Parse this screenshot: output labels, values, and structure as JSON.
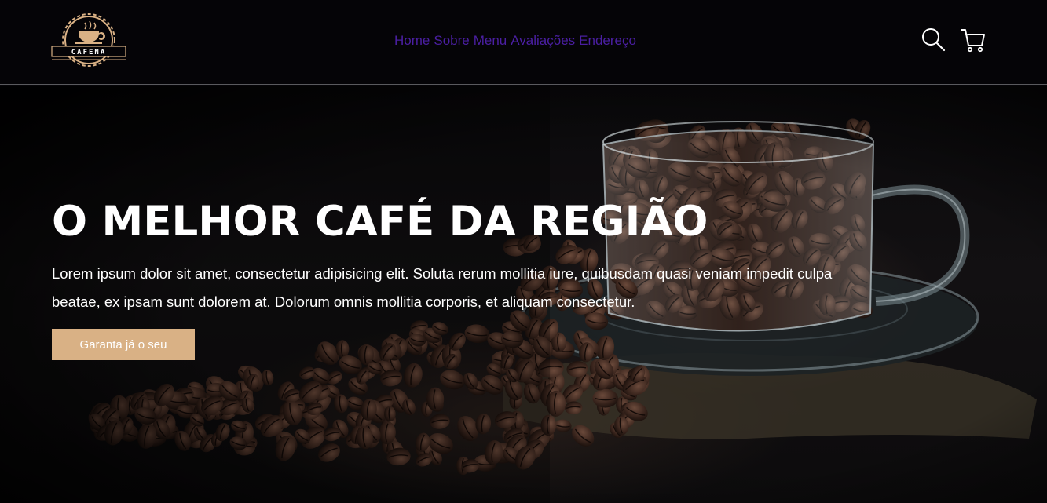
{
  "header": {
    "logo_text": "CAFENA",
    "nav": [
      "Home",
      "Sobre",
      "Menu",
      "Avaliações",
      "Endereço"
    ],
    "icons": [
      "search-icon",
      "cart-icon"
    ]
  },
  "hero": {
    "title": "O MELHOR CAFÉ DA REGIÃO",
    "description": "Lorem ipsum dolor sit amet, consectetur adipisicing elit. Soluta rerum mollitia iure, quibusdam quasi veniam impedit culpa beatae, ex ipsam sunt dolorem at. Dolorum omnis mollitia corporis, et aliquam consectetur.",
    "cta_label": "Garanta já o seu"
  },
  "colors": {
    "background": "#050407",
    "nav_link": "#4b1fa3",
    "accent": "#d9b185",
    "text": "#ffffff"
  }
}
